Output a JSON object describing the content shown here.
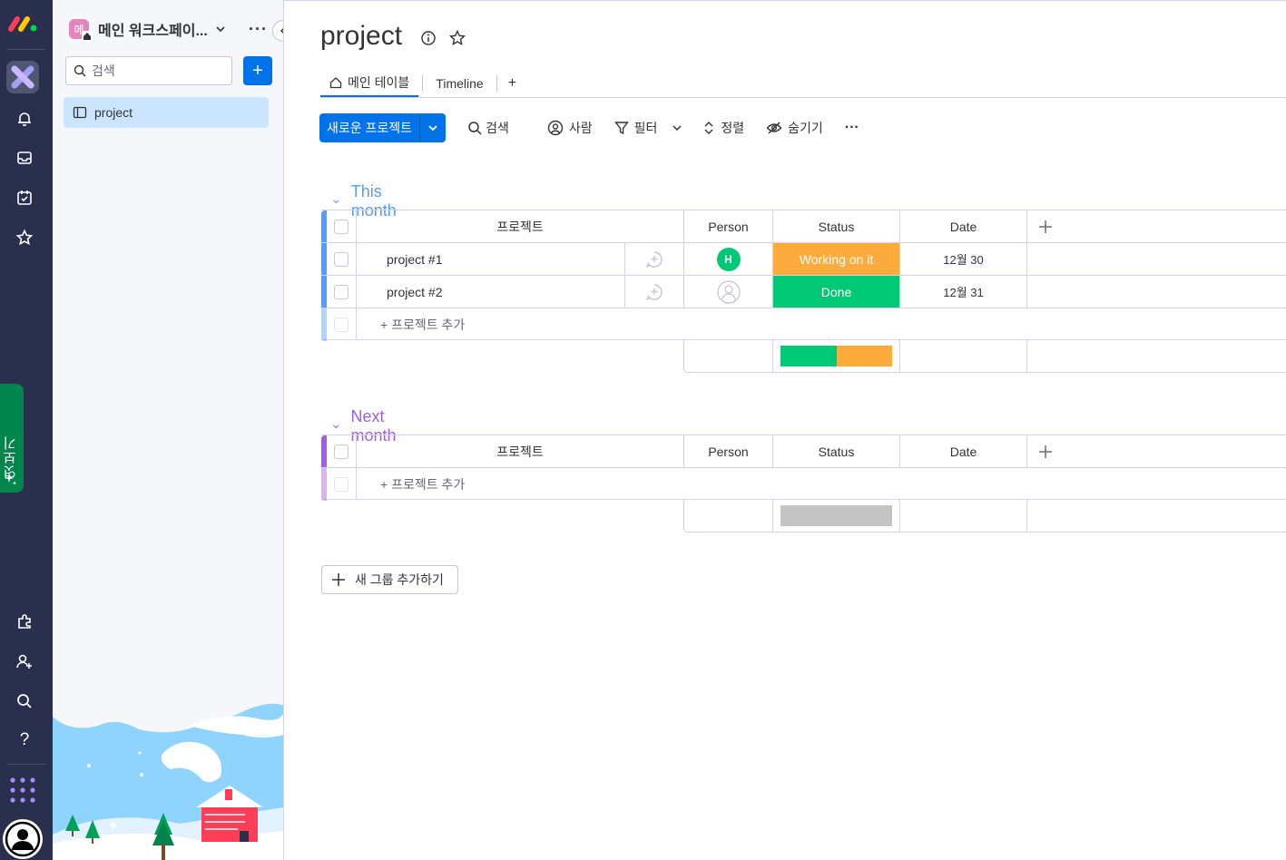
{
  "colors": {
    "accent": "#0073ea",
    "this_month_group": "#579bfc",
    "next_month_group": "#a25ddc",
    "working_on_it": "#fdab3d",
    "done": "#00c875",
    "empty_status": "#c4c4c4"
  },
  "rail": {
    "vertical_tab": "엿보기"
  },
  "sidebar": {
    "workspace_avatar": "메",
    "workspace_name": "메인 워크스페이...",
    "search_placeholder": "검색",
    "add_label": "+",
    "items": [
      {
        "label": "project"
      }
    ]
  },
  "board": {
    "title": "project",
    "tabs": [
      {
        "label": "메인 테이블"
      },
      {
        "label": "Timeline"
      }
    ],
    "tab_add": "+",
    "toolbar": {
      "new_item": "새로운 프로젝트",
      "search": "검색",
      "person": "사람",
      "filter": "필터",
      "sort": "정렬",
      "hide": "숨기기",
      "more": "···"
    },
    "columns": {
      "name": "프로젝트",
      "person": "Person",
      "status": "Status",
      "date": "Date"
    },
    "add_item": "+ 프로젝트 추가",
    "add_group": "새 그룹 추가하기",
    "groups": [
      {
        "title": "This month",
        "rows": [
          {
            "name": "project #1",
            "person": "H",
            "status": "Working on it",
            "date": "12월 30"
          },
          {
            "name": "project #2",
            "person": "",
            "status": "Done",
            "date": "12월 31"
          }
        ],
        "status_summary": [
          {
            "status": "Done",
            "fraction": 0.5
          },
          {
            "status": "Working on it",
            "fraction": 0.5
          }
        ]
      },
      {
        "title": "Next month",
        "rows": [],
        "status_summary": []
      }
    ]
  }
}
